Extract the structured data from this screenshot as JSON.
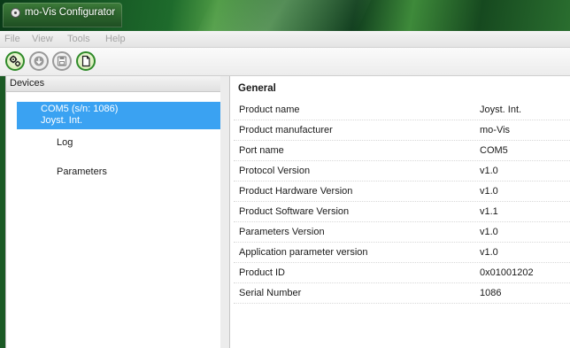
{
  "window": {
    "title": "mo-Vis Configurator"
  },
  "menu": [
    "File",
    "View",
    "Tools",
    "Help"
  ],
  "toolbar": {
    "buttons": [
      {
        "icon": "gears-icon",
        "state": "enabled"
      },
      {
        "icon": "download-icon",
        "state": "disabled"
      },
      {
        "icon": "save-icon",
        "state": "disabled"
      },
      {
        "icon": "document-icon",
        "state": "enabled"
      }
    ]
  },
  "devices": {
    "header": "Devices",
    "selected_device": {
      "line1": "COM5 (s/n: 1086)",
      "line2": "Joyst. Int."
    },
    "children": [
      "Log",
      "Parameters"
    ]
  },
  "general": {
    "title": "General",
    "rows": [
      {
        "name": "Product name",
        "value": "Joyst. Int."
      },
      {
        "name": "Product manufacturer",
        "value": "mo-Vis"
      },
      {
        "name": "Port name",
        "value": "COM5"
      },
      {
        "name": "Protocol Version",
        "value": "v1.0"
      },
      {
        "name": "Product Hardware Version",
        "value": "v1.0"
      },
      {
        "name": "Product Software Version",
        "value": "v1.1"
      },
      {
        "name": "Parameters Version",
        "value": "v1.0"
      },
      {
        "name": "Application parameter version",
        "value": "v1.0"
      },
      {
        "name": "Product ID",
        "value": "0x01001202"
      },
      {
        "name": "Serial Number",
        "value": "1086"
      }
    ]
  },
  "colors": {
    "selection": "#3aa2f2",
    "active_button": "#2f8a2a",
    "title_bar": "#1e6b2c"
  }
}
